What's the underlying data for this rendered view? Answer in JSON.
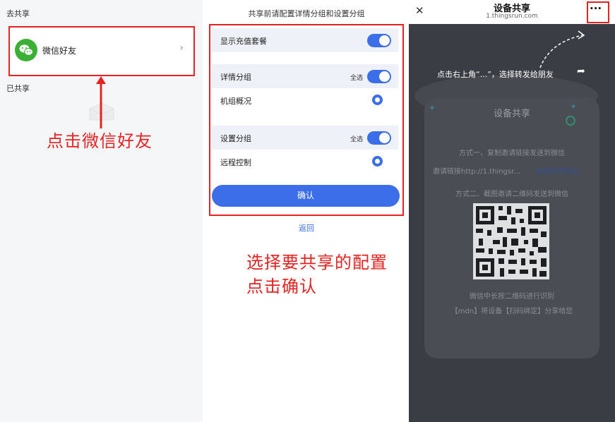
{
  "panel1": {
    "section_to_share": "去共享",
    "wechat_label": "微信好友",
    "chevron": "›",
    "section_shared": "已共享",
    "annotation": "点击微信好友"
  },
  "panel2": {
    "title": "共享前请配置详情分组和设置分组",
    "show_package": "显示充值套餐",
    "detail_group": "详情分组",
    "select_all": "全选",
    "unit_overview": "机组概况",
    "settings_group": "设置分组",
    "remote_control": "远程控制",
    "confirm": "确认",
    "back": "返回",
    "annotation_line1": "选择要共享的配置",
    "annotation_line2": "点击确认"
  },
  "panel3": {
    "close": "✕",
    "page_title": "设备共享",
    "domain": "1.thingsrun.com",
    "more": "···",
    "hint": "点击右上角“...”，选择转发给朋友",
    "share_arrow": "➦",
    "card_title": "设备共享",
    "method1": "方式一、复制邀请链接发送到微信",
    "invite_link": "邀请链接http://1.thingsr...",
    "copy_link": "复制邀请链接",
    "method2": "方式二、截图邀请二维码发送到微信",
    "qr_hint": "微信中长按二维码进行识别",
    "qr_desc": "【mdn】将设备【扫码绑定】分享给您"
  },
  "colors": {
    "accent": "#3b6ee8",
    "annotation_red": "#e62222",
    "wechat_green": "#3cb034"
  }
}
